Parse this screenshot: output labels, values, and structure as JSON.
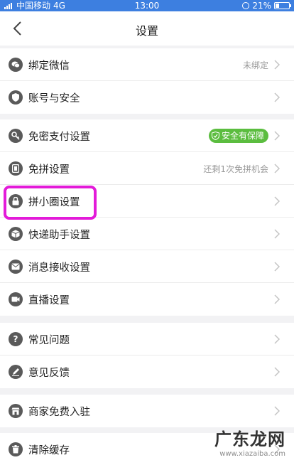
{
  "status_bar": {
    "carrier": "中国移动",
    "network": "4G",
    "time": "13:00",
    "battery": "21%"
  },
  "nav": {
    "title": "设置"
  },
  "groups": [
    {
      "items": [
        {
          "label": "绑定微信",
          "value": "未绑定",
          "icon": "wechat-icon"
        },
        {
          "label": "账号与安全",
          "value": "",
          "icon": "shield-icon"
        }
      ]
    },
    {
      "items": [
        {
          "label": "免密支付设置",
          "badge": "安全有保障",
          "icon": "key-icon"
        },
        {
          "label": "免拼设置",
          "value": "还剩1次免拼机会",
          "icon": "coupon-icon"
        },
        {
          "label": "拼小圈设置",
          "value": "",
          "icon": "lock-icon"
        },
        {
          "label": "快递助手设置",
          "value": "",
          "icon": "package-icon"
        },
        {
          "label": "消息接收设置",
          "value": "",
          "icon": "mail-icon"
        },
        {
          "label": "直播设置",
          "value": "",
          "icon": "video-icon"
        }
      ]
    },
    {
      "items": [
        {
          "label": "常见问题",
          "value": "",
          "icon": "question-icon"
        },
        {
          "label": "意见反馈",
          "value": "",
          "icon": "edit-icon"
        }
      ]
    },
    {
      "items": [
        {
          "label": "商家免费入驻",
          "value": "",
          "icon": "store-icon"
        }
      ]
    },
    {
      "items": [
        {
          "label": "清除缓存",
          "value": "",
          "icon": "trash-icon"
        }
      ]
    }
  ],
  "watermark": {
    "main": "广东龙网",
    "sub": "www.xiazaiba.com"
  },
  "colors": {
    "status_bar": "#3d7fe0",
    "badge": "#5bbd3f",
    "highlight": "#e31bd9",
    "icon": "#5a5a5a"
  }
}
